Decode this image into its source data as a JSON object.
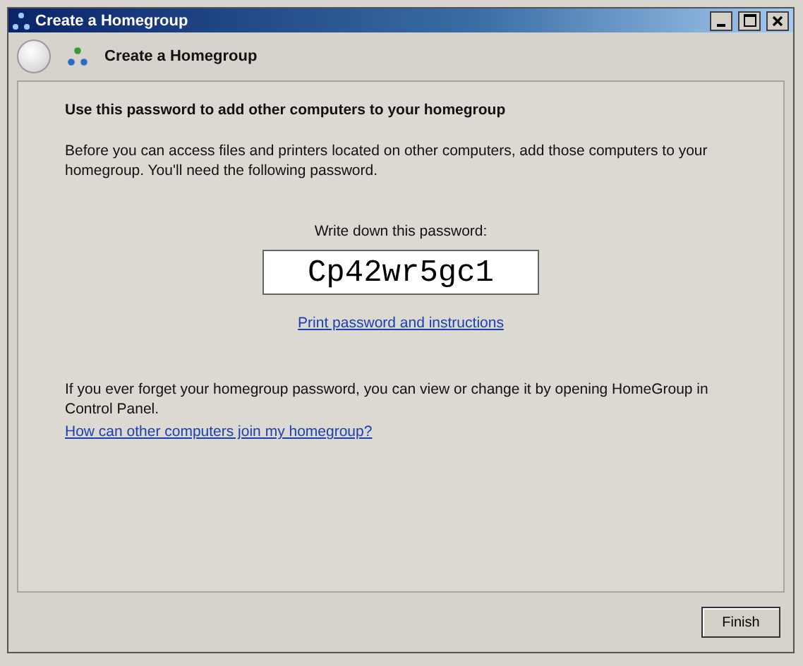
{
  "window": {
    "title": "Create a Homegroup"
  },
  "header": {
    "title": "Create a Homegroup"
  },
  "heading": "Use this password to add other computers to your homegroup",
  "intro": "Before you can access files and printers located on other computers, add those computers to your homegroup. You'll need the following password.",
  "password_label": "Write down this password:",
  "password": "Cp42wr5gc1",
  "print_link": "Print password and instructions",
  "forget_note": "If you ever forget your homegroup password, you can view or change it by opening HomeGroup in Control Panel.",
  "help_link": "How can other computers join my homegroup?",
  "buttons": [
    {
      "label": "Finish"
    }
  ]
}
